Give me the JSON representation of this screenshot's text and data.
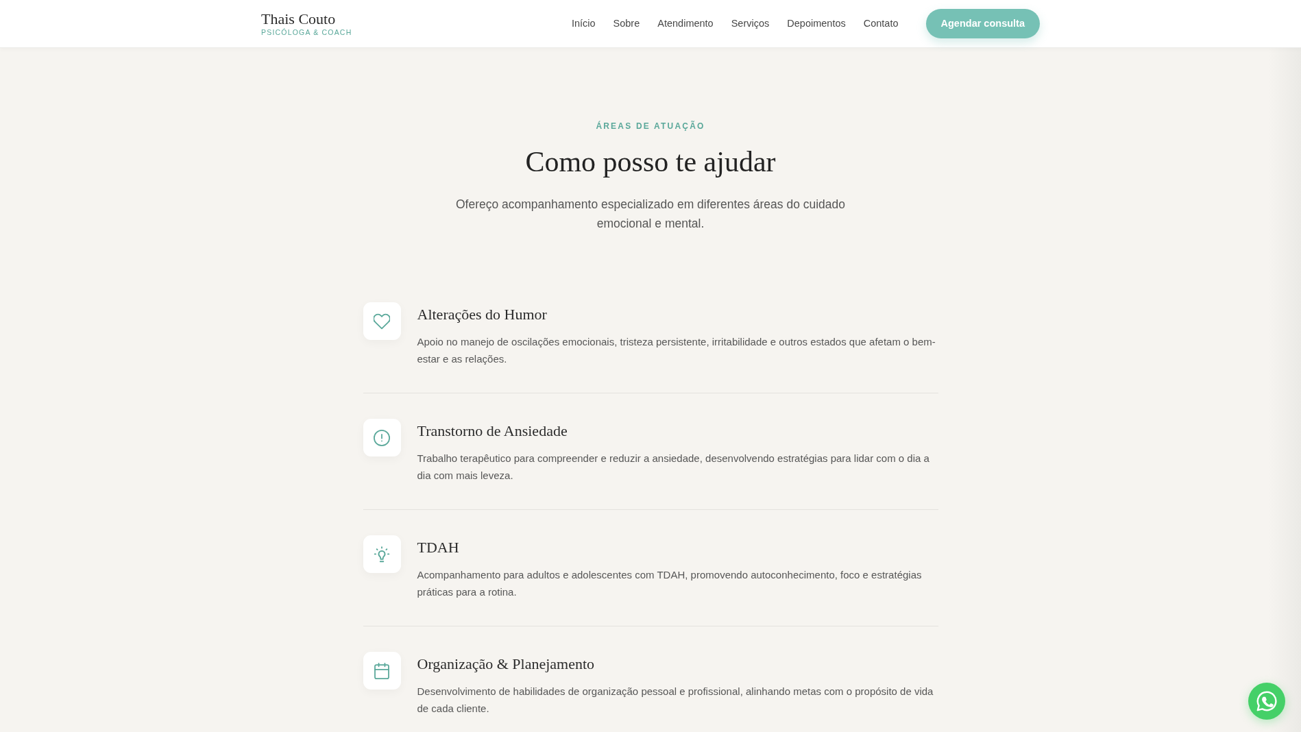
{
  "brand": {
    "name": "Thais Couto",
    "tagline": "PSICÓLOGA & COACH"
  },
  "nav": {
    "links": [
      "Início",
      "Sobre",
      "Atendimento",
      "Serviços",
      "Depoimentos",
      "Contato"
    ],
    "cta": "Agendar consulta"
  },
  "section": {
    "eyebrow": "ÁREAS DE ATUAÇÃO",
    "title": "Como posso te ajudar",
    "intro": "Ofereço acompanhamento especializado em diferentes áreas do cuidado emocional e mental."
  },
  "services": [
    {
      "title": "Alterações do Humor",
      "description": "Apoio no manejo de oscilações emocionais, tristeza persistente, irritabilidade e outros estados que afetam o bem-estar e as relações."
    },
    {
      "title": "Transtorno de Ansiedade",
      "description": "Trabalho terapêutico para compreender e reduzir a ansiedade, desenvolvendo estratégias para lidar com o dia a dia com mais leveza."
    },
    {
      "title": "TDAH",
      "description": "Acompanhamento para adultos e adolescentes com TDAH, promovendo autoconhecimento, foco e estratégias práticas para a rotina."
    },
    {
      "title": "Organização & Planejamento",
      "description": "Desenvolvimento de habilidades de organização pessoal e profissional, alinhando metas com o propósito de vida de cada cliente."
    }
  ]
}
